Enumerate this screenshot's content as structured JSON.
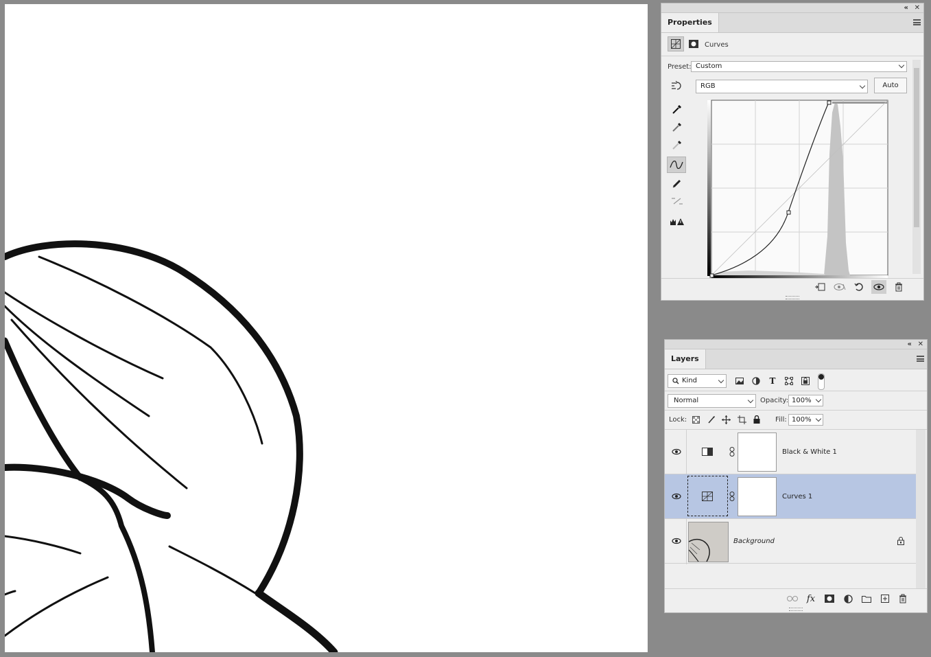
{
  "properties": {
    "tab_title": "Properties",
    "adjustment_type": "Curves",
    "preset_label": "Preset:",
    "preset_value": "Custom",
    "channel_value": "RGB",
    "auto_label": "Auto",
    "tools": [
      "target-adjust-icon",
      "sample-black-eyedropper-icon",
      "sample-gray-eyedropper-icon",
      "sample-white-eyedropper-icon",
      "curve-points-icon",
      "pencil-draw-icon",
      "smooth-curve-icon",
      "clipping-warning-icon"
    ],
    "footer_icons": [
      "clip-to-layer-icon",
      "view-previous-icon",
      "reset-icon",
      "visibility-icon",
      "delete-icon"
    ]
  },
  "layers": {
    "tab_title": "Layers",
    "filter_kind": "Kind",
    "blend_mode": "Normal",
    "opacity_label": "Opacity:",
    "opacity_value": "100%",
    "lock_label": "Lock:",
    "fill_label": "Fill:",
    "fill_value": "100%",
    "items": [
      {
        "name": "Black & White 1",
        "type": "adjustment",
        "selected": false
      },
      {
        "name": "Curves 1",
        "type": "adjustment",
        "selected": true
      },
      {
        "name": "Background",
        "type": "image",
        "selected": false,
        "locked": true
      }
    ],
    "footer_icons": [
      "link-layers-icon",
      "fx-icon",
      "add-mask-icon",
      "new-adjustment-icon",
      "new-group-icon",
      "new-layer-icon",
      "delete-layer-icon"
    ]
  },
  "topbar": {
    "collapse_glyph": "«",
    "close_glyph": "✕"
  }
}
